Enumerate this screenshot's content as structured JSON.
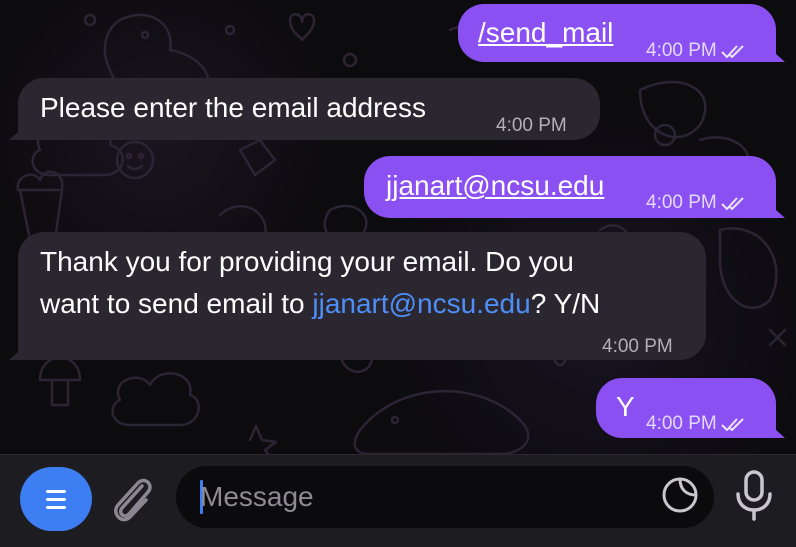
{
  "messages": [
    {
      "direction": "out",
      "text": "/send_mail",
      "time": "4:00 PM",
      "status": "read"
    },
    {
      "direction": "in",
      "text": "Please enter the email address",
      "time": "4:00 PM"
    },
    {
      "direction": "out",
      "text": "jjanart@ncsu.edu",
      "time": "4:00 PM",
      "status": "read"
    },
    {
      "direction": "in",
      "text_line1": "Thank you for providing your email. Do you",
      "text_line2_prefix": "want to send email to ",
      "text_line2_link": "jjanart@ncsu.edu",
      "text_line2_suffix": "? Y/N",
      "time": "4:00 PM"
    },
    {
      "direction": "out",
      "text": "Y",
      "time": "4:00 PM",
      "status": "read"
    }
  ],
  "composer": {
    "placeholder": "Message",
    "menu_icon": "menu-icon",
    "attach_icon": "paperclip-icon",
    "sticker_icon": "sticker-icon",
    "mic_icon": "microphone-icon"
  },
  "colors": {
    "outgoing_bubble": "#8b50f2",
    "incoming_bubble": "#2b2730",
    "link": "#4e8ef7",
    "accent": "#3d7ef2"
  }
}
